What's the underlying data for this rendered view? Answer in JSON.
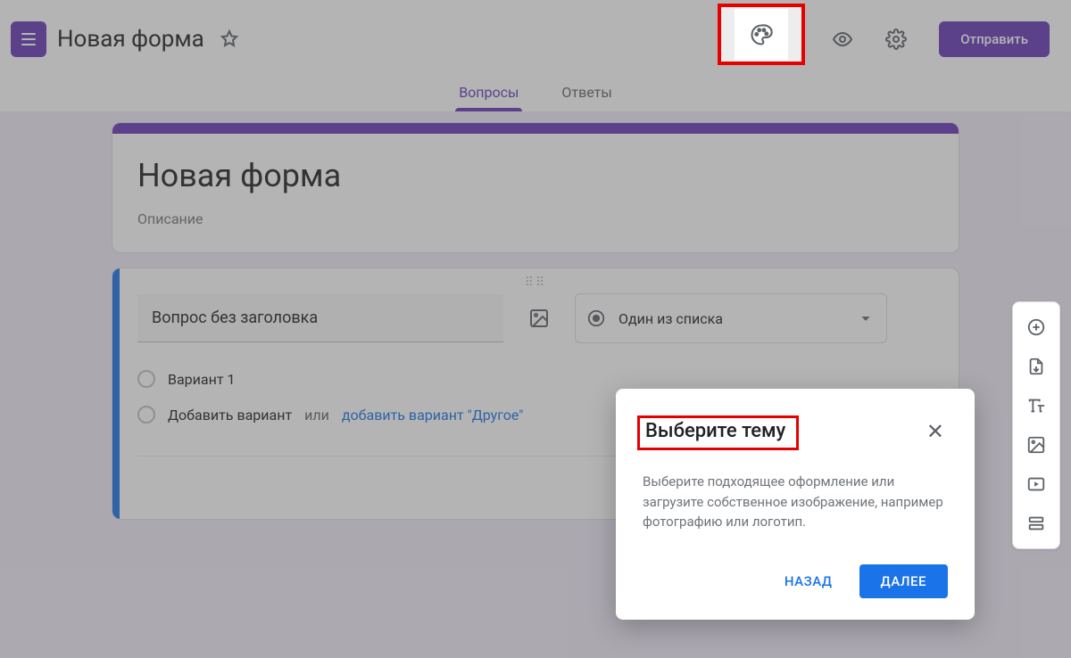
{
  "header": {
    "form_title": "Новая форма",
    "send_label": "Отправить"
  },
  "tabs": {
    "questions": "Вопросы",
    "responses": "Ответы"
  },
  "title_card": {
    "title": "Новая форма",
    "description": "Описание"
  },
  "question": {
    "placeholder": "Вопрос без заголовка",
    "type_label": "Один из списка",
    "option1": "Вариант 1",
    "add_option": "Добавить вариант",
    "or": "или",
    "add_other": "добавить вариант \"Другое\""
  },
  "dialog": {
    "title": "Выберите тему",
    "body": "Выберите подходящее оформление или загрузите собственное изображение, например фотографию или логотип.",
    "back": "НАЗАД",
    "next": "ДАЛЕЕ"
  }
}
